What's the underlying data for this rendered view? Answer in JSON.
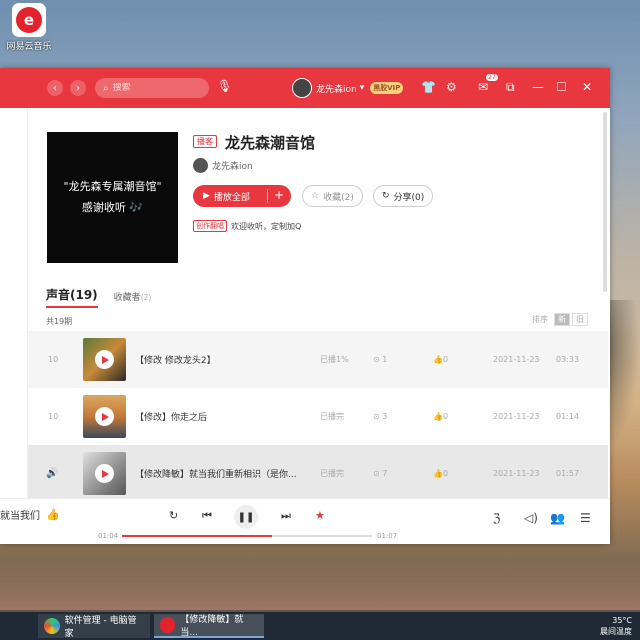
{
  "desktop": {
    "icon_label": "网易云音乐",
    "icon_glyph": "e"
  },
  "app": {
    "search_placeholder": "搜索",
    "user_name": "龙先森ion",
    "vip_label": "黑胶VIP",
    "message_badge": "27"
  },
  "playlist": {
    "cover_line1": "\"龙先森专属潮音馆\"",
    "cover_line2": "感谢收听 🎶",
    "tag": "播客",
    "title": "龙先森潮音馆",
    "creator": "龙先森ion",
    "play_all": "播放全部",
    "collect": "收藏(2)",
    "share": "分享(0)",
    "desc_tag": "创作翻唱",
    "desc": "欢迎收听，定制加Q",
    "tab_sounds": "声音(19)",
    "tab_subscribers": "收藏者",
    "tab_subscribers_count": "(2)",
    "episode_count": "共19期",
    "sort_label": "排序",
    "sort_opt1": "新",
    "sort_opt2": "旧"
  },
  "episodes": [
    {
      "num": "10",
      "title": "【修改 修改龙头2】",
      "progress": "已播1%",
      "plays": "1",
      "likes": "0",
      "date": "2021-11-23",
      "duration": "03:33"
    },
    {
      "num": "10",
      "title": "【修改】你走之后",
      "progress": "已播完",
      "plays": "3",
      "likes": "0",
      "date": "2021-11-23",
      "duration": "01:14"
    },
    {
      "num": "",
      "title": "【修改降敏】就当我们重新相识（是你...",
      "progress": "已播完",
      "plays": "7",
      "likes": "0",
      "date": "2021-11-23",
      "duration": "01:57"
    }
  ],
  "player": {
    "song": "就当我们",
    "time_current": "01:04",
    "time_total": "01:07",
    "progress_fraction": 0.6
  },
  "taskbar": {
    "item1": "软件管理 - 电脑管家",
    "item2": "【修改降敏】就当...",
    "temp": "35°C",
    "weather": "晨间温度"
  }
}
